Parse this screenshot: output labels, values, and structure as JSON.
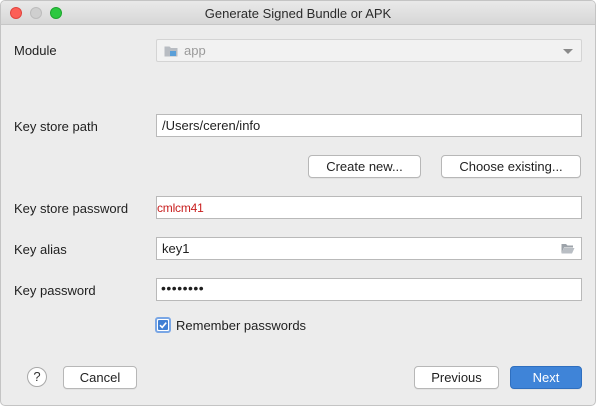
{
  "window": {
    "title": "Generate Signed Bundle or APK"
  },
  "module": {
    "label": "Module",
    "value": "app"
  },
  "key_store_path": {
    "label": "Key store path",
    "value": "/Users/ceren/info"
  },
  "buttons": {
    "create_new": "Create new...",
    "choose_existing": "Choose existing..."
  },
  "key_store_password": {
    "label": "Key store password",
    "value": "cmlcm41"
  },
  "key_alias": {
    "label": "Key alias",
    "value": "key1"
  },
  "key_password": {
    "label": "Key password",
    "value": "••••••••"
  },
  "remember": {
    "label": "Remember passwords",
    "checked": true
  },
  "footer": {
    "help": "?",
    "cancel": "Cancel",
    "previous": "Previous",
    "next": "Next"
  },
  "colors": {
    "accent": "#3f84d8",
    "password_text": "#c81e1e"
  },
  "icons": {
    "module": "folder-icon",
    "alias_browse": "open-folder-icon",
    "dropdown": "chevron-down-icon",
    "checkbox": "checkmark-icon"
  }
}
